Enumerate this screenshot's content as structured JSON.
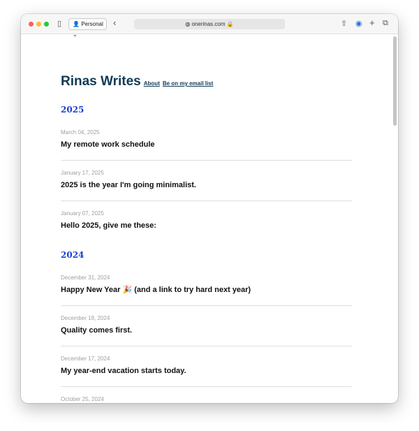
{
  "browser": {
    "profile": "Personal",
    "url": "onerinas.com"
  },
  "site": {
    "title": "Rinas Writes",
    "nav": [
      "About",
      "Be on my email list"
    ]
  },
  "years": [
    {
      "year": "2025",
      "posts": [
        {
          "date": "March 04, 2025",
          "title": "My remote work schedule"
        },
        {
          "date": "January 17, 2025",
          "title": "2025 is the year I'm going minimalist."
        },
        {
          "date": "January 07, 2025",
          "title": "Hello 2025, give me these:"
        }
      ]
    },
    {
      "year": "2024",
      "posts": [
        {
          "date": "December 31, 2024",
          "title": "Happy New Year 🎉 (and a link to try hard next year)"
        },
        {
          "date": "December 18, 2024",
          "title": "Quality comes first."
        },
        {
          "date": "December 17, 2024",
          "title": "My year-end vacation starts today."
        },
        {
          "date": "October 25, 2024",
          "title": "I feel dumb."
        }
      ]
    }
  ]
}
